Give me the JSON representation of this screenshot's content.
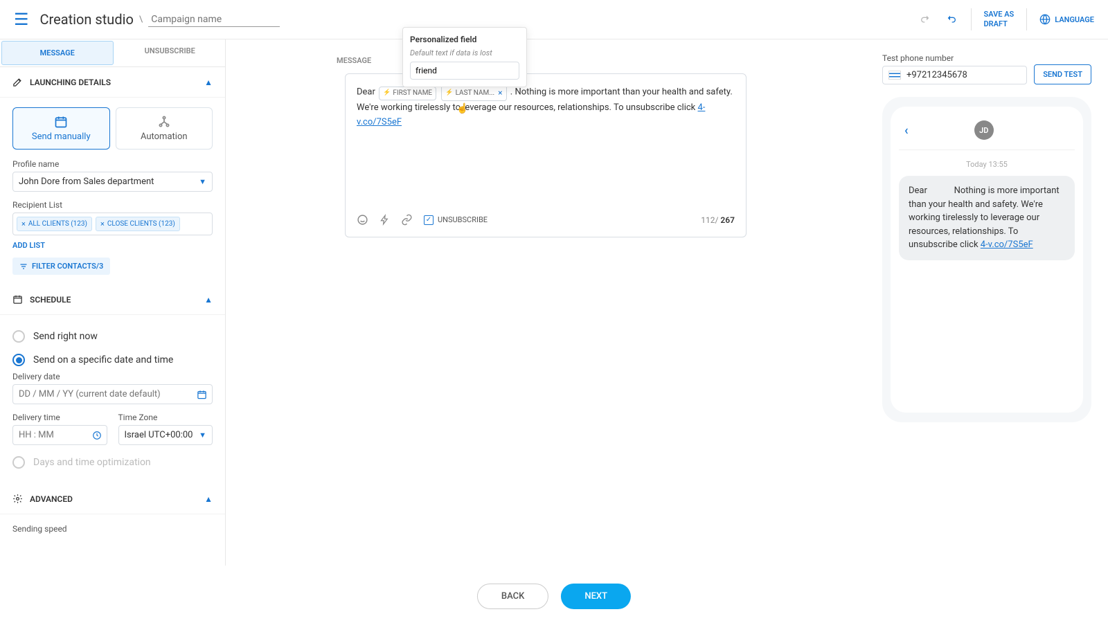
{
  "topbar": {
    "brand": "Creation studio",
    "campaign_placeholder": "Campaign name",
    "save_draft": "SAVE AS\nDRAFT",
    "language": "LANGUAGE"
  },
  "tabs": {
    "message": "MESSAGE",
    "unsubscribe": "UNSUBSCRIBE"
  },
  "launching": {
    "header": "LAUNCHING DETAILS",
    "send_manually": "Send manually",
    "automation": "Automation",
    "profile_label": "Profile name",
    "profile_value": "John Dore from Sales department",
    "recipient_label": "Recipient List",
    "chip1": "ALL CLIENTS (123)",
    "chip2": "CLOSE CLIENTS (123)",
    "add_list": "ADD LIST",
    "filter": "FILTER CONTACTS/3"
  },
  "schedule": {
    "header": "SCHEDULE",
    "opt_now": "Send right now",
    "opt_specific": "Send on a specific date and time",
    "opt_optim": "Days and time optimization",
    "date_label": "Delivery date",
    "date_placeholder": "DD / MM / YY (current date default)",
    "time_label": "Delivery time",
    "time_placeholder": "HH : MM",
    "tz_label": "Time Zone",
    "tz_value": "Israel UTC+00:00"
  },
  "advanced": {
    "header": "ADVANCED",
    "sending_speed": "Sending speed"
  },
  "editor": {
    "header": "MESSAGE",
    "dear": "Dear ",
    "pill1": "FIRST NAME",
    "pill2": "LAST NAM...",
    "body": ". Nothing is more important than your health and safety. We're working tirelessly to leverage our resources, relationships. To unsubscribe click ",
    "link": "4-v.co/7S5eF",
    "unsub_label": "UNSUBSCRIBE",
    "count_cur": "112",
    "count_max": "267"
  },
  "popover": {
    "title": "Personalized field",
    "hint": "Default text if data is lost",
    "value": "friend"
  },
  "preview": {
    "test_label": "Test phone number",
    "test_value": "+97212345678",
    "send_test": "SEND TEST",
    "avatar": "JD",
    "time": "Today 13:55",
    "bubble_pre": "Dear            Nothing is more important than your health and safety. We're working tirelessly to leverage our resources, relationships. To unsubscribe click ",
    "bubble_link": "4-v.co/7S5eF"
  },
  "footer": {
    "back": "BACK",
    "next": "NEXT"
  }
}
